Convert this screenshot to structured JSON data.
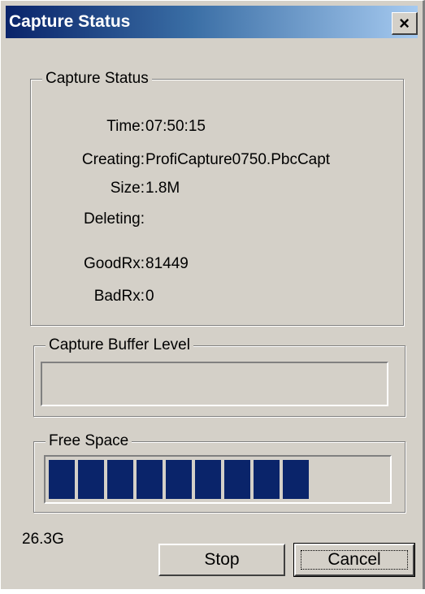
{
  "window": {
    "title": "Capture Status",
    "close_glyph": "×"
  },
  "capture_status": {
    "group_label": "Capture Status",
    "time_label": "Time:",
    "time_value": "07:50:15",
    "creating_label": "Creating:",
    "creating_value": "ProfiCapture0750.PbcCapt",
    "size_label": "Size:",
    "size_value": "1.8M",
    "deleting_label": "Deleting:",
    "deleting_value": "",
    "goodrx_label": "GoodRx:",
    "goodrx_value": "81449",
    "badrx_label": "BadRx:",
    "badrx_value": "0"
  },
  "buffer_level": {
    "group_label": "Capture Buffer Level",
    "progress_fraction": 0.0
  },
  "free_space": {
    "group_label": "Free Space",
    "filled_blocks": 9,
    "bar_color": "#0a246a",
    "value_text": "26.3G"
  },
  "buttons": {
    "stop_label": "Stop",
    "cancel_label": "Cancel"
  },
  "colors": {
    "dialog_face": "#d4d0c8",
    "title_start": "#0a246a",
    "title_end": "#a6caf0"
  }
}
